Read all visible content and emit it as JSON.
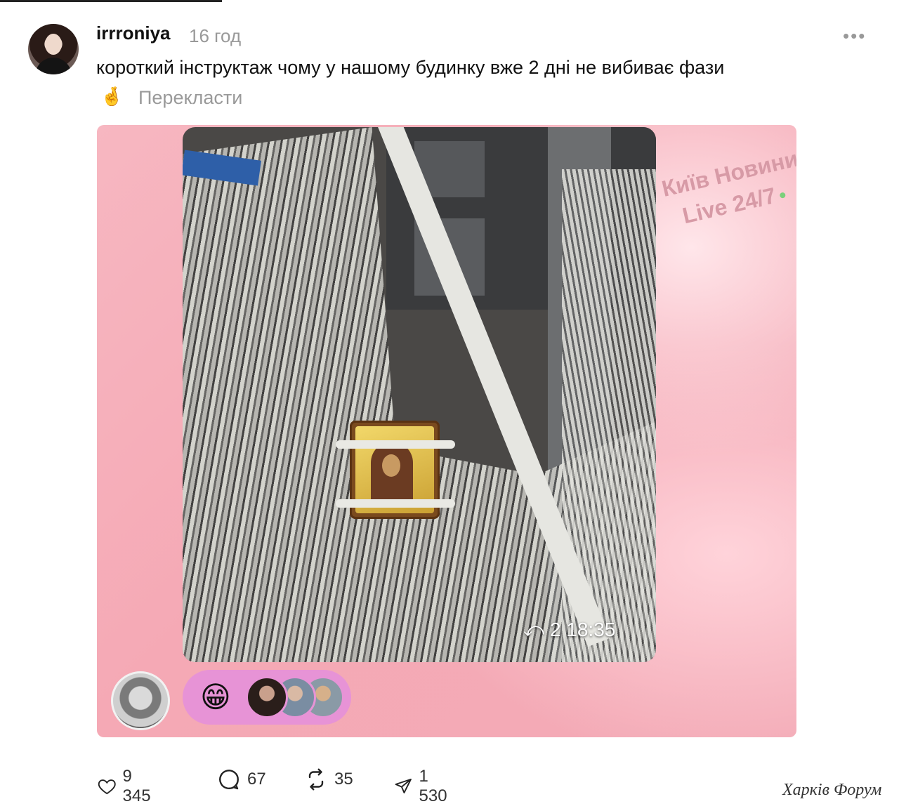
{
  "post": {
    "username": "irrroniya",
    "time": "16 год",
    "more_label": "•••",
    "caption": "короткий інструктаж чому у нашому будинку вже 2 дні не вибиває фази",
    "translate_label": "Перекласти"
  },
  "media": {
    "counter": "2 18:35",
    "watermark": {
      "line1": "Київ Новини",
      "line2": "Live 24/7"
    },
    "reaction_emoji": "😁"
  },
  "stats": {
    "likes": "9 345",
    "comments": "67",
    "reposts": "35",
    "shares": "1 530"
  },
  "footer": {
    "forum_watermark": "Харків Форум"
  },
  "icons": {
    "translate": "crossed-fingers-icon",
    "like": "heart-icon",
    "comment": "speech-bubble-icon",
    "repost": "repost-arrows-icon",
    "share": "send-plane-icon",
    "reply_arrow": "reply-arrow-icon"
  },
  "colors": {
    "card_pink": "#f5a9b5",
    "reaction_pill": "#e793d6",
    "watermark_pink": "#d79aa6",
    "muted_text": "#999999"
  }
}
